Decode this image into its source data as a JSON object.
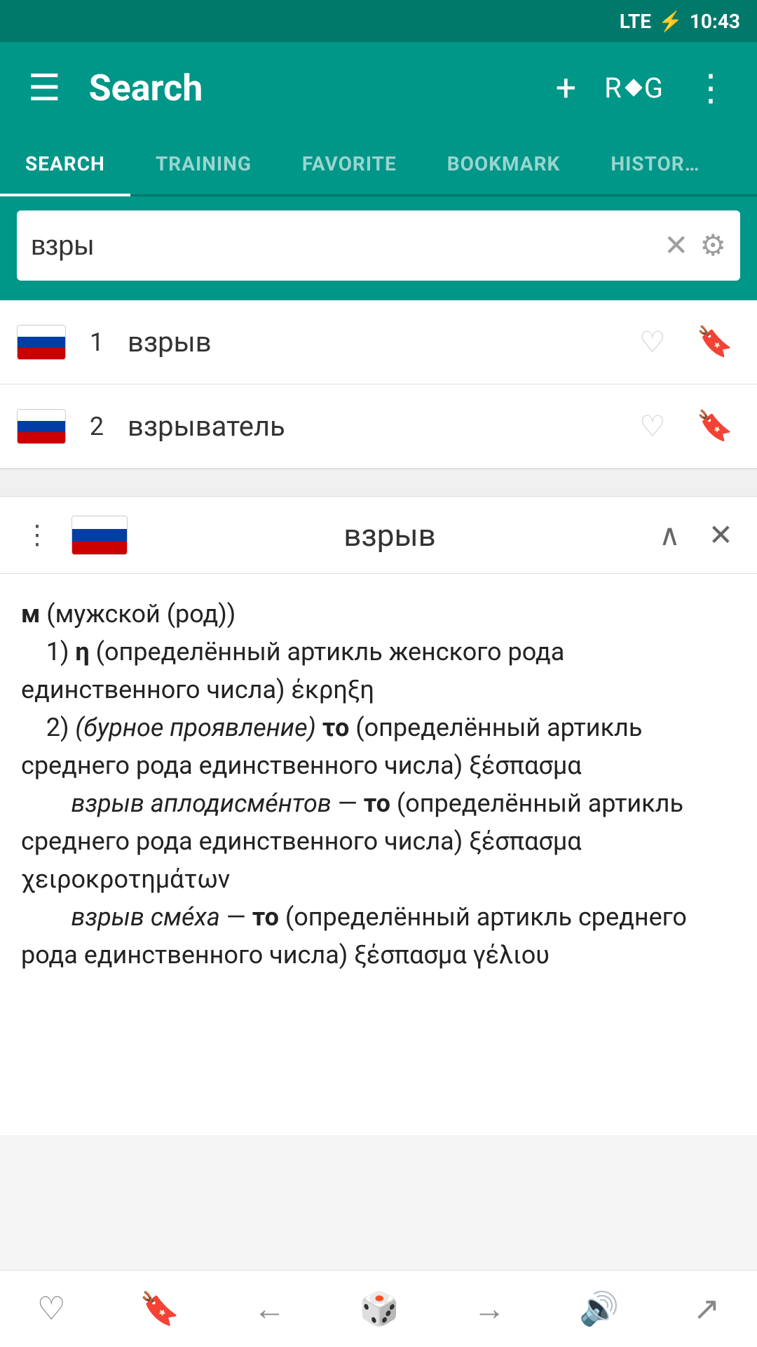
{
  "status_bar": {
    "signal": "LTE",
    "battery": "⚡",
    "time": "10:43"
  },
  "toolbar": {
    "menu_icon": "☰",
    "title": "Search",
    "add_icon": "+",
    "rdg_label": "R",
    "rdg_diamond": "◆",
    "rdg_g": "G",
    "more_icon": "⋮"
  },
  "tabs": [
    {
      "id": "search",
      "label": "SEARCH",
      "active": true
    },
    {
      "id": "training",
      "label": "TRAINING",
      "active": false
    },
    {
      "id": "favorite",
      "label": "FAVORITE",
      "active": false
    },
    {
      "id": "bookmark",
      "label": "BOOKMARK",
      "active": false
    },
    {
      "id": "history",
      "label": "HISTOR…",
      "active": false
    }
  ],
  "search": {
    "value": "взры",
    "clear_icon": "✕",
    "settings_icon": "⚙"
  },
  "results": [
    {
      "id": 1,
      "num": "1",
      "word": "взрыв"
    },
    {
      "id": 2,
      "num": "2",
      "word": "взрыватель"
    }
  ],
  "detail": {
    "menu_icon": "⋮",
    "word": "взрыв",
    "collapse_icon": "∧",
    "close_icon": "✕",
    "definition_html": "<span class='gram'>м</span> (мужской (род))<br>    1) <span class='gram'>η</span> (определённый артикль женского рода единственного числа) έκρηξη<br>    2) <span class='italic'>(бурное проявление)</span> <span class='bold'>το</span> (определённый артикль среднего рода единственного числа) ξέσπασμα<br>        <span class='italic'>взрыв аплодисме́нтов</span> — <span class='bold'>то</span> (определённый артикль среднего рода единственного числа) ξέσπασμα χειροκροτημάτων<br>        <span class='italic'>взрыв сме́ха</span> — <span class='bold'>то</span> (определённый артикль среднего рода единственного числа) ξέσπασμα γέλιου"
  },
  "bottom_bar": {
    "heart_icon": "♡",
    "bookmark_icon": "🔖",
    "back_icon": "←",
    "dice_icon": "🎲",
    "forward_icon": "→",
    "sound_icon": "🔊",
    "share_icon": "↗"
  }
}
